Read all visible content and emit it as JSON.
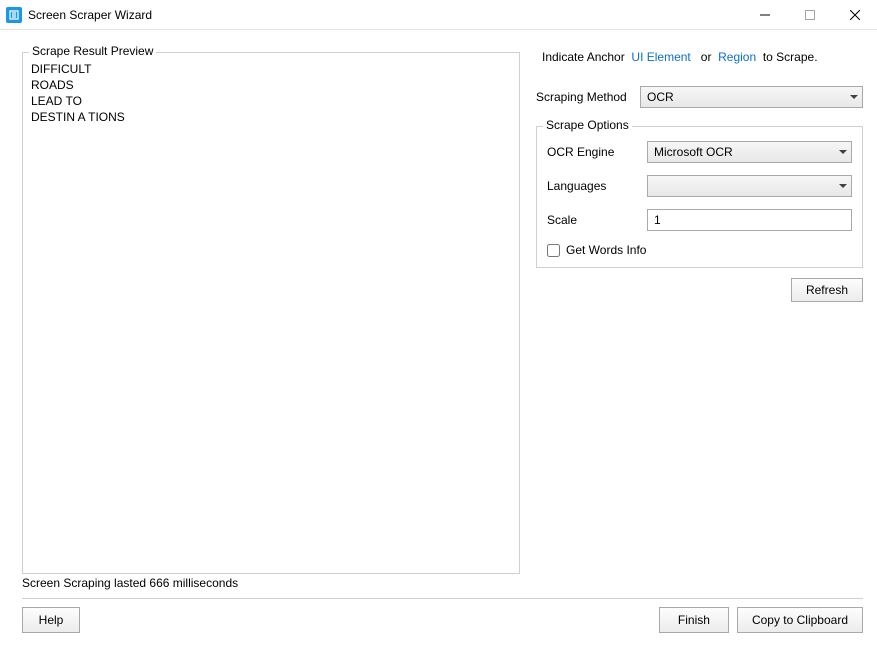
{
  "window": {
    "title": "Screen Scraper Wizard"
  },
  "preview": {
    "legend": "Scrape Result Preview",
    "text": "DIFFICULT\nROADS\nLEAD TO\nDESTIN A TIONS"
  },
  "anchor": {
    "prefix": "Indicate Anchor",
    "ui_element": "UI Element",
    "or": "or",
    "region": "Region",
    "suffix": "to Scrape."
  },
  "method": {
    "label": "Scraping Method",
    "value": "OCR"
  },
  "options": {
    "legend": "Scrape Options",
    "ocr_engine_label": "OCR Engine",
    "ocr_engine_value": "Microsoft OCR",
    "languages_label": "Languages",
    "languages_value": "",
    "scale_label": "Scale",
    "scale_value": "1",
    "get_words_label": "Get Words Info"
  },
  "buttons": {
    "refresh": "Refresh",
    "help": "Help",
    "finish": "Finish",
    "copy": "Copy to Clipboard"
  },
  "status": "Screen Scraping lasted 666 milliseconds"
}
